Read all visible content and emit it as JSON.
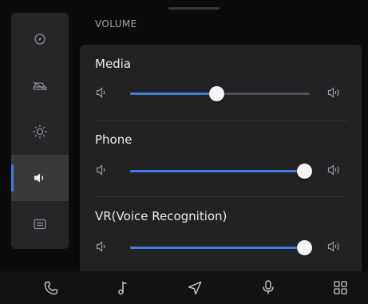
{
  "settings": {
    "section_title": "VOLUME"
  },
  "side_nav": {
    "items": [
      {
        "icon": "compass-icon",
        "active": false
      },
      {
        "icon": "car-icon",
        "active": false
      },
      {
        "icon": "brightness-icon",
        "active": false
      },
      {
        "icon": "speaker-icon",
        "active": true
      },
      {
        "icon": "card-icon",
        "active": false
      }
    ]
  },
  "volume": {
    "media": {
      "label": "Media",
      "level": 0.48
    },
    "phone": {
      "label": "Phone",
      "level": 0.97
    },
    "vr": {
      "label": "VR(Voice Recognition)",
      "level": 0.97
    }
  },
  "bottom_bar": {
    "items": [
      "phone-icon",
      "music-icon",
      "navigation-icon",
      "microphone-icon",
      "apps-grid-icon"
    ]
  },
  "colors": {
    "accent": "#3f7de0",
    "background": "#0b0b0c",
    "panel": "#222224",
    "sidebar": "#262628"
  }
}
